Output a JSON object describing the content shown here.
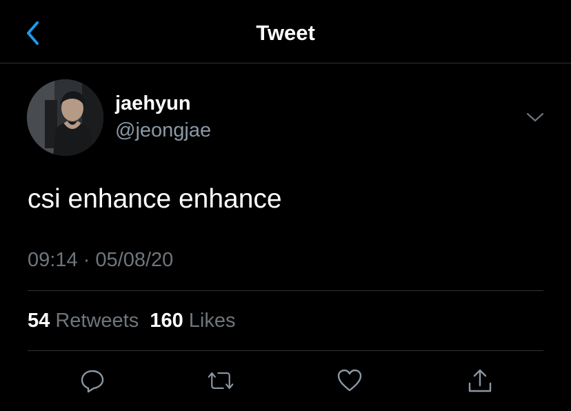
{
  "header": {
    "title": "Tweet",
    "back_icon": "chevron-left-icon"
  },
  "author": {
    "display_name": "jaehyun",
    "handle": "@jeongjae",
    "avatar_icon": "profile-photo",
    "more_icon": "chevron-down-icon"
  },
  "tweet": {
    "text": "csi enhance enhance",
    "time": "09:14",
    "separator": "·",
    "date": "05/08/20"
  },
  "stats": {
    "retweets_count": "54",
    "retweets_label": "Retweets",
    "likes_count": "160",
    "likes_label": "Likes"
  },
  "actions": [
    {
      "name": "reply",
      "icon": "reply-icon"
    },
    {
      "name": "retweet",
      "icon": "retweet-icon"
    },
    {
      "name": "like",
      "icon": "heart-icon"
    },
    {
      "name": "share",
      "icon": "share-icon"
    }
  ],
  "colors": {
    "background": "#000000",
    "accent": "#1d9bf0",
    "secondary_text": "#6e767d",
    "divider": "#2f3336"
  }
}
